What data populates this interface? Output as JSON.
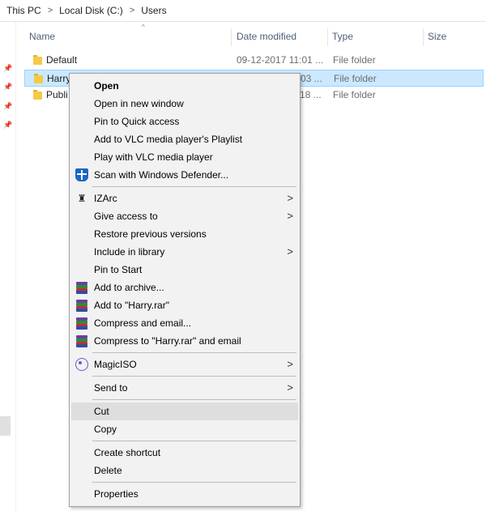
{
  "breadcrumb": [
    "This PC",
    "Local Disk (C:)",
    "Users"
  ],
  "columns": {
    "name": "Name",
    "date_modified": "Date modified",
    "type": "Type",
    "size": "Size"
  },
  "files": [
    {
      "name": "Default",
      "date": "09-12-2017 11:01 ...",
      "type": "File folder",
      "selected": false
    },
    {
      "name": "Harry",
      "date": "...03 ...",
      "type": "File folder",
      "selected": true
    },
    {
      "name": "Publi",
      "date": "...18 ...",
      "type": "File folder",
      "selected": false
    }
  ],
  "context_menu": {
    "open": "Open",
    "open_new_window": "Open in new window",
    "pin_quick_access": "Pin to Quick access",
    "add_vlc_playlist": "Add to VLC media player's Playlist",
    "play_vlc": "Play with VLC media player",
    "scan_defender": "Scan with Windows Defender...",
    "izarc": "IZArc",
    "give_access": "Give access to",
    "restore_versions": "Restore previous versions",
    "include_library": "Include in library",
    "pin_start": "Pin to Start",
    "add_archive": "Add to archive...",
    "add_rar": "Add to \"Harry.rar\"",
    "compress_email": "Compress and email...",
    "compress_rar_email": "Compress to \"Harry.rar\" and email",
    "magiciso": "MagicISO",
    "send_to": "Send to",
    "cut": "Cut",
    "copy": "Copy",
    "create_shortcut": "Create shortcut",
    "delete": "Delete",
    "properties": "Properties"
  },
  "colors": {
    "selection_bg": "#cce8ff",
    "menu_bg": "#f2f2f2",
    "hover_bg": "#dedede",
    "header_text": "#4c607a"
  }
}
